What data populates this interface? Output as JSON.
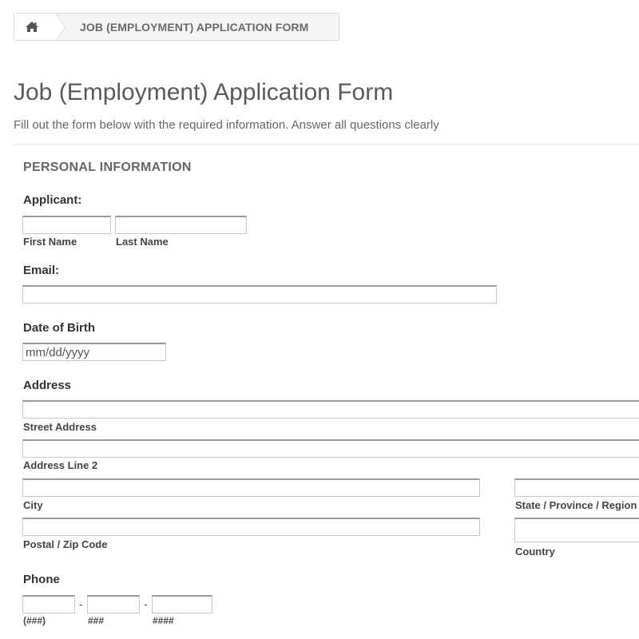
{
  "breadcrumb": {
    "home_icon": "home-icon",
    "current": "JOB (EMPLOYMENT) APPLICATION FORM"
  },
  "header": {
    "title": "Job (Employment) Application Form",
    "subtitle": "Fill out the form below with the required information. Answer all questions clearly"
  },
  "section": {
    "title": "PERSONAL INFORMATION"
  },
  "fields": {
    "applicant": {
      "label": "Applicant:",
      "first_name": {
        "sublabel": "First Name",
        "value": ""
      },
      "last_name": {
        "sublabel": "Last Name",
        "value": ""
      }
    },
    "email": {
      "label": "Email:",
      "value": ""
    },
    "dob": {
      "label": "Date of Birth",
      "value": "",
      "placeholder": "mm/dd/yyyy"
    },
    "address": {
      "label": "Address",
      "street": {
        "sublabel": "Street Address",
        "value": ""
      },
      "line2": {
        "sublabel": "Address Line 2",
        "value": ""
      },
      "city": {
        "sublabel": "City",
        "value": ""
      },
      "state": {
        "sublabel": "State / Province / Region",
        "value": ""
      },
      "postal": {
        "sublabel": "Postal / Zip Code",
        "value": ""
      },
      "country": {
        "sublabel": "Country",
        "value": ""
      }
    },
    "phone": {
      "label": "Phone",
      "separator": "-",
      "area": {
        "sublabel": "(###)",
        "value": ""
      },
      "prefix": {
        "sublabel": "###",
        "value": ""
      },
      "line": {
        "sublabel": "####",
        "value": ""
      }
    }
  }
}
